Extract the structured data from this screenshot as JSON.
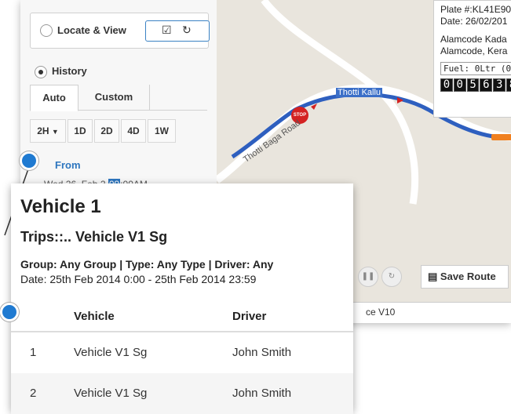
{
  "left_panel": {
    "locate_view_label": "Locate & View",
    "history_label": "History",
    "tabs": [
      {
        "label": "Auto"
      },
      {
        "label": "Custom"
      }
    ],
    "ranges": [
      {
        "label": "2H"
      },
      {
        "label": "1D"
      },
      {
        "label": "2D"
      },
      {
        "label": "4D"
      },
      {
        "label": "1W"
      }
    ],
    "from_label": "From",
    "from_date": "Wed 26, Feb 2",
    "from_time_highlight": "09",
    "from_time_rest": ":00AM"
  },
  "map": {
    "street_label_1": "Thotti Kallu",
    "street_label_2": "Thotti Baga Road",
    "stop_sign": "STOP",
    "save_route_label": "Save Route",
    "bottom_label": "ce V10"
  },
  "vehicle_info": {
    "plate": "Plate #:KL41E90",
    "date": "Date: 26/02/201",
    "location1": "Alamcode Kada",
    "location2": "Alamcode, Kera",
    "fuel": "Fuel: 0Ltr (0%)",
    "odometer": [
      "0",
      "0",
      "5",
      "6",
      "3",
      "8"
    ]
  },
  "popup": {
    "title": "Vehicle 1",
    "subtitle": "Trips::.. Vehicle V1 Sg",
    "meta": "Group: Any Group | Type: Any Type | Driver: Any",
    "date_range": "Date: 25th Feb 2014 0:00 -  25th Feb 2014 23:59",
    "columns": [
      "",
      "Vehicle",
      "Driver"
    ],
    "rows": [
      [
        "1",
        "Vehicle V1 Sg",
        "John Smith"
      ],
      [
        "2",
        "Vehicle V1 Sg",
        "John Smith"
      ]
    ]
  },
  "colors": {
    "accent": "#2e76bf",
    "route": "#2e5fbf",
    "callout_dot": "#1f7ad1"
  }
}
